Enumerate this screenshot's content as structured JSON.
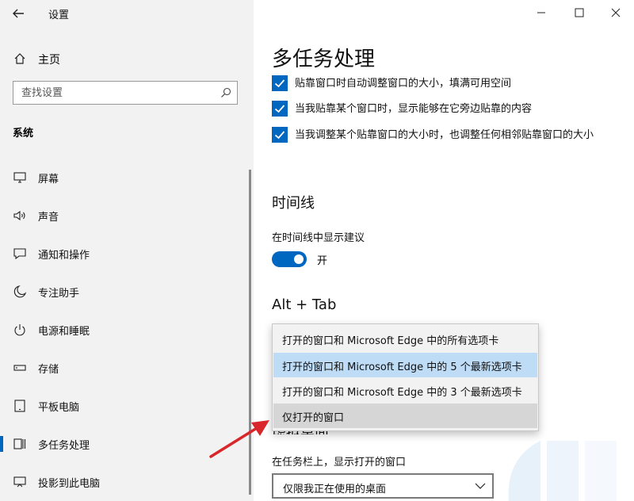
{
  "window": {
    "title": "设置"
  },
  "sidebar": {
    "home_label": "主页",
    "search_placeholder": "查找设置",
    "section_label": "系统",
    "items": [
      {
        "label": "屏幕",
        "icon": "monitor-icon"
      },
      {
        "label": "声音",
        "icon": "speaker-icon"
      },
      {
        "label": "通知和操作",
        "icon": "notification-icon"
      },
      {
        "label": "专注助手",
        "icon": "moon-icon"
      },
      {
        "label": "电源和睡眠",
        "icon": "power-icon"
      },
      {
        "label": "存储",
        "icon": "storage-icon"
      },
      {
        "label": "平板电脑",
        "icon": "tablet-icon"
      },
      {
        "label": "多任务处理",
        "icon": "multitasking-icon",
        "active": true
      },
      {
        "label": "投影到此电脑",
        "icon": "projection-icon"
      }
    ]
  },
  "main": {
    "title": "多任务处理",
    "snap_options": [
      {
        "label": "贴靠窗口时自动调整窗口的大小，填满可用空间",
        "checked": true
      },
      {
        "label": "当我贴靠某个窗口时，显示能够在它旁边贴靠的内容",
        "checked": true
      },
      {
        "label": "当我调整某个贴靠窗口的大小时，也调整任何相邻贴靠窗口的大小",
        "checked": true
      }
    ],
    "timeline": {
      "heading": "时间线",
      "suggestion_label": "在时间线中显示建议",
      "toggle_state": "开",
      "toggle_on": true
    },
    "alt_tab": {
      "heading": "Alt + Tab",
      "options": [
        "打开的窗口和 Microsoft Edge 中的所有选项卡",
        "打开的窗口和 Microsoft Edge 中的 5 个最新选项卡",
        "打开的窗口和 Microsoft Edge 中的 3 个最新选项卡",
        "仅打开的窗口"
      ],
      "selected_index": 1,
      "hover_index": 3
    },
    "partial_heading": "虚拟桌面",
    "taskbar_label": "在任务栏上，显示打开的窗口",
    "taskbar_select_value": "仅限我正在使用的桌面"
  },
  "colors": {
    "accent": "#0067c0",
    "sidebar_bg": "#f2f2f2",
    "arrow": "#d9262a"
  }
}
